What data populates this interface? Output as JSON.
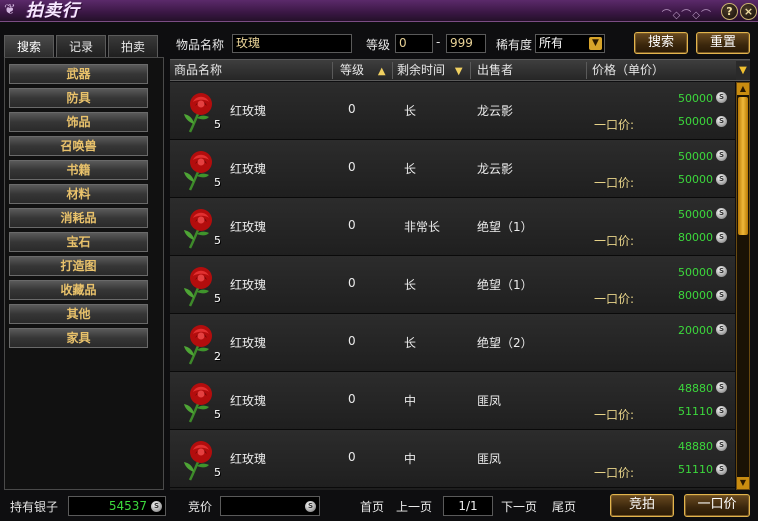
{
  "window": {
    "title": "拍卖行",
    "help_label": "?",
    "close_label": "×"
  },
  "tabs": [
    {
      "label": "搜索",
      "active": true
    },
    {
      "label": "记录",
      "active": false
    },
    {
      "label": "拍卖",
      "active": false
    }
  ],
  "categories": [
    "武器",
    "防具",
    "饰品",
    "召唤兽",
    "书籍",
    "材料",
    "消耗品",
    "宝石",
    "打造图",
    "收藏品",
    "其他",
    "家具"
  ],
  "search": {
    "name_label": "物品名称",
    "name_value": "玫瑰",
    "level_label": "等级",
    "level_min": "0",
    "level_sep": "-",
    "level_max": "999",
    "rarity_label": "稀有度",
    "rarity_value": "所有",
    "search_button": "搜索",
    "reset_button": "重置"
  },
  "table": {
    "headers": {
      "name": "商品名称",
      "level": "等级",
      "time": "剩余时间",
      "seller": "出售者",
      "price": "价格（单价）"
    },
    "buyout_label": "一口价:",
    "rows": [
      {
        "name": "红玫瑰",
        "qty": "5",
        "level": "0",
        "time": "长",
        "seller": "龙云影",
        "bid": "50000",
        "buyout": "50000"
      },
      {
        "name": "红玫瑰",
        "qty": "5",
        "level": "0",
        "time": "长",
        "seller": "龙云影",
        "bid": "50000",
        "buyout": "50000"
      },
      {
        "name": "红玫瑰",
        "qty": "5",
        "level": "0",
        "time": "非常长",
        "seller": "绝望（1）",
        "bid": "50000",
        "buyout": "80000"
      },
      {
        "name": "红玫瑰",
        "qty": "5",
        "level": "0",
        "time": "长",
        "seller": "绝望（1）",
        "bid": "50000",
        "buyout": "80000"
      },
      {
        "name": "红玫瑰",
        "qty": "2",
        "level": "0",
        "time": "长",
        "seller": "绝望（2）",
        "bid": "20000",
        "buyout": ""
      },
      {
        "name": "红玫瑰",
        "qty": "5",
        "level": "0",
        "time": "中",
        "seller": "匪凤",
        "bid": "48880",
        "buyout": "51110"
      },
      {
        "name": "红玫瑰",
        "qty": "5",
        "level": "0",
        "time": "中",
        "seller": "匪凤",
        "bid": "48880",
        "buyout": "51110"
      }
    ]
  },
  "footer": {
    "silver_label": "持有银子",
    "silver_value": "54537",
    "bid_label": "竞价",
    "first_page": "首页",
    "prev_page": "上一页",
    "page_indicator": "1/1",
    "next_page": "下一页",
    "last_page": "尾页",
    "bid_button": "竞拍",
    "buyout_button": "一口价"
  },
  "colors": {
    "accent_gold": "#e2b44d",
    "price_green": "#3cd83c",
    "category_text": "#e9c26b",
    "title_bar": "#3a1744"
  }
}
